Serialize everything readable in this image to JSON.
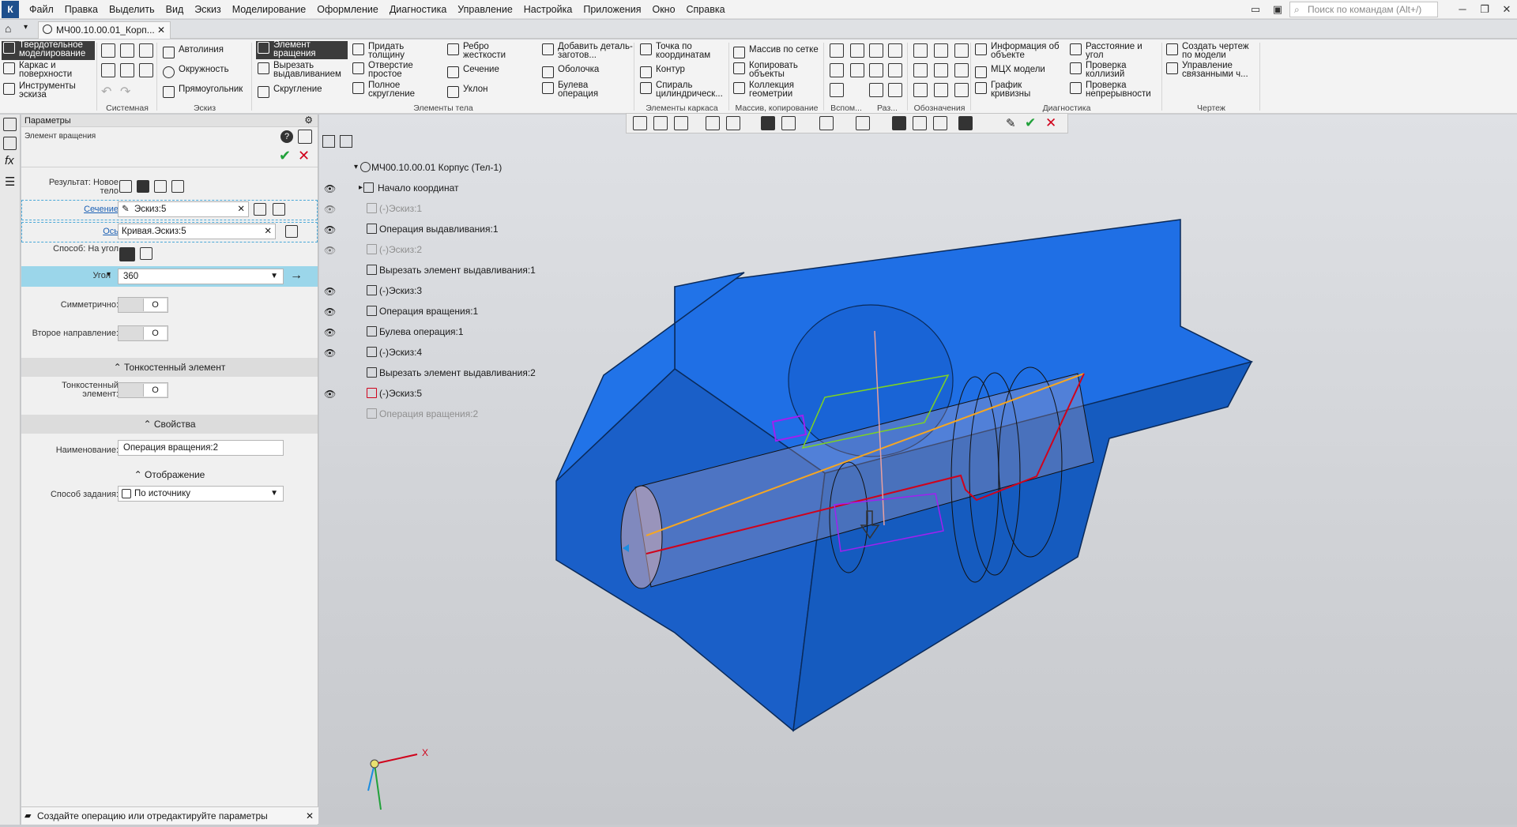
{
  "menubar": {
    "items": [
      "Файл",
      "Правка",
      "Выделить",
      "Вид",
      "Эскиз",
      "Моделирование",
      "Оформление",
      "Диагностика",
      "Управление",
      "Настройка",
      "Приложения",
      "Окно",
      "Справка"
    ],
    "search_placeholder": "Поиск по командам (Alt+/)"
  },
  "tabs": {
    "doc": "МЧ00.10.00.01_Корп..."
  },
  "ribbon": {
    "left": [
      "Твердотельное моделирование",
      "Каркас и поверхности",
      "Инструменты эскиза"
    ],
    "sketch": [
      "Автолиния",
      "Окружность",
      "Прямоугольник"
    ],
    "body1": [
      "Элемент вращения",
      "Вырезать выдавливанием",
      "Скругление"
    ],
    "body2": [
      "Придать толщину",
      "Отверстие простое",
      "Полное скругление"
    ],
    "body3": [
      "Ребро жесткости",
      "Сечение",
      "Уклон"
    ],
    "body4": [
      "Добавить деталь-заготов...",
      "Оболочка",
      "Булева операция"
    ],
    "frame": [
      "Точка по координатам",
      "Контур",
      "Спираль цилиндрическ..."
    ],
    "arr": [
      "Массив по сетке",
      "Копировать объекты",
      "Коллекция геометрии"
    ],
    "diag1": [
      "Информация об объекте",
      "МЦХ модели",
      "График кривизны"
    ],
    "diag2": [
      "Расстояние и угол",
      "Проверка коллизий",
      "Проверка непрерывности"
    ],
    "draw": [
      "Создать чертеж по модели",
      "Управление связанными ч..."
    ],
    "groups": [
      "Системная",
      "Эскиз",
      "Элементы тела",
      "Элементы каркаса",
      "Массив, копирование",
      "Вспом...",
      "Раз...",
      "Обозначения",
      "Диагностика",
      "Чертеж"
    ]
  },
  "panel": {
    "title": "Параметры",
    "op": "Элемент вращения",
    "result_label": "Результат: Новое тело",
    "section_label": "Сечение",
    "section_value": "Эскиз:5",
    "axis_label": "Ось",
    "axis_value": "Кривая.Эскиз:5",
    "method_label": "Способ: На угол",
    "angle_label": "Угол",
    "angle_value": "360",
    "sym_label": "Симметрично:",
    "second_label": "Второе направление:",
    "thin_section": "Тонкостенный элемент",
    "thin_label": "Тонкостенный элемент:",
    "props_section": "Свойства",
    "name_label": "Наименование:",
    "name_value": "Операция вращения:2",
    "display_section": "Отображение",
    "mode_label": "Способ задания:",
    "mode_value": "По источнику",
    "toggle_glyph": "O"
  },
  "status": "Создайте операцию или отредактируйте параметры",
  "tree": {
    "root": "МЧ00.10.00.01 Корпус (Тел-1)",
    "items": [
      "Начало координат",
      "(-)Эскиз:1",
      "Операция выдавливания:1",
      "(-)Эскиз:2",
      "Вырезать элемент выдавливания:1",
      "(-)Эскиз:3",
      "Операция вращения:1",
      "Булева операция:1",
      "(-)Эскиз:4",
      "Вырезать элемент выдавливания:2",
      "(-)Эскиз:5",
      "Операция вращения:2"
    ]
  },
  "axis_label": "X",
  "colors": {
    "body": "#1e6fe8",
    "accent": "#f5a623",
    "sketch": "#d0021b",
    "ok": "#21a13a",
    "cancel": "#d0021b"
  }
}
